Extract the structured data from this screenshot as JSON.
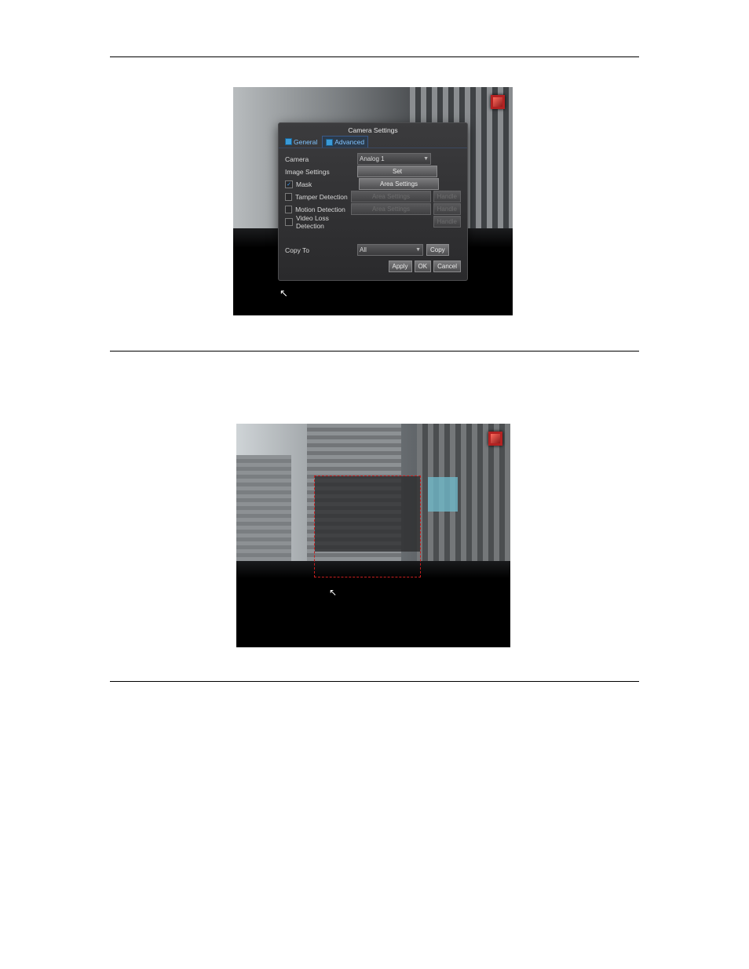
{
  "dialog": {
    "title": "Camera Settings",
    "tabs": {
      "general": "General",
      "advanced": "Advanced"
    },
    "rows": {
      "camera": {
        "label": "Camera",
        "value": "Analog 1"
      },
      "image": {
        "label": "Image Settings",
        "button": "Set"
      },
      "mask": {
        "label": "Mask",
        "button": "Area Settings"
      },
      "tamper": {
        "label": "Tamper Detection",
        "button": "Area Settings",
        "handle": "Handle"
      },
      "motion": {
        "label": "Motion Detection",
        "button": "Area Settings",
        "handle": "Handle"
      },
      "videoloss": {
        "label": "Video Loss Detection",
        "handle": "Handle"
      }
    },
    "copy": {
      "label": "Copy To",
      "value": "All",
      "button": "Copy"
    },
    "footer": {
      "apply": "Apply",
      "ok": "OK",
      "cancel": "Cancel"
    }
  }
}
